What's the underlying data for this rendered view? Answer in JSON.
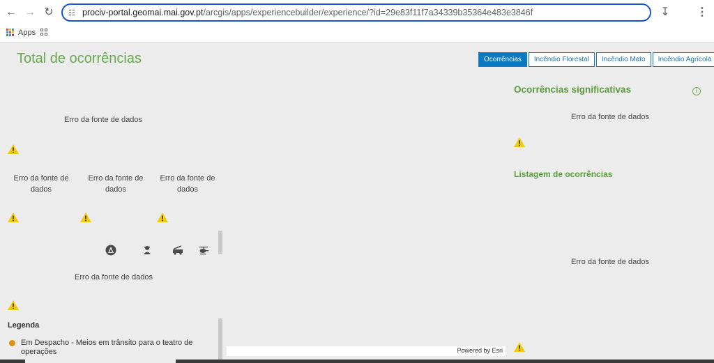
{
  "browser": {
    "url_domain": "prociv-portal.geomai.mai.gov.pt",
    "url_path": "/arcgis/apps/experiencebuilder/experience/?id=29e83f11f7a34339b35364e483e3846f",
    "bookmark_apps": "Apps"
  },
  "app": {
    "title": "Total de ocorrências",
    "tabs": [
      "Ocorrências",
      "Incêndio Florestal",
      "Incêndio Mato",
      "Incêndio Agrícola"
    ],
    "error_text": "Erro da fonte de dados",
    "right": {
      "significant_title": "Ocorrências significativas",
      "list_title": "Listagem de ocorrências"
    },
    "legend": {
      "title": "Legenda",
      "items": [
        {
          "label": "Em Despacho - Meios em trânsito para o teatro de operações",
          "color": "#e08e0b"
        }
      ]
    },
    "powered_by": "Powered by Esri"
  },
  "colors": {
    "accent": "#6aa84f",
    "tab_blue": "#0b79c1",
    "warning": "#f2cc0c"
  }
}
